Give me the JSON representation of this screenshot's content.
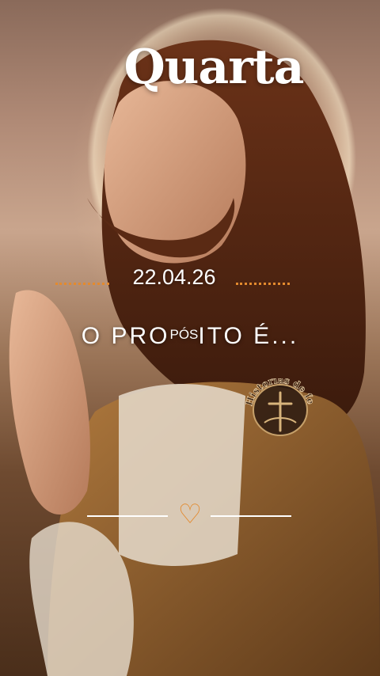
{
  "header": {
    "day_label": "Quarta"
  },
  "date": {
    "value": "22.04.26"
  },
  "message": {
    "prefix": "O PRO",
    "small": "PÓS",
    "suffix": "ITO É..."
  },
  "badge": {
    "text": "Historias de fe"
  },
  "divider": {
    "icon": "heart-icon"
  },
  "colors": {
    "accent": "#e38a2e",
    "text": "#ffffff"
  }
}
